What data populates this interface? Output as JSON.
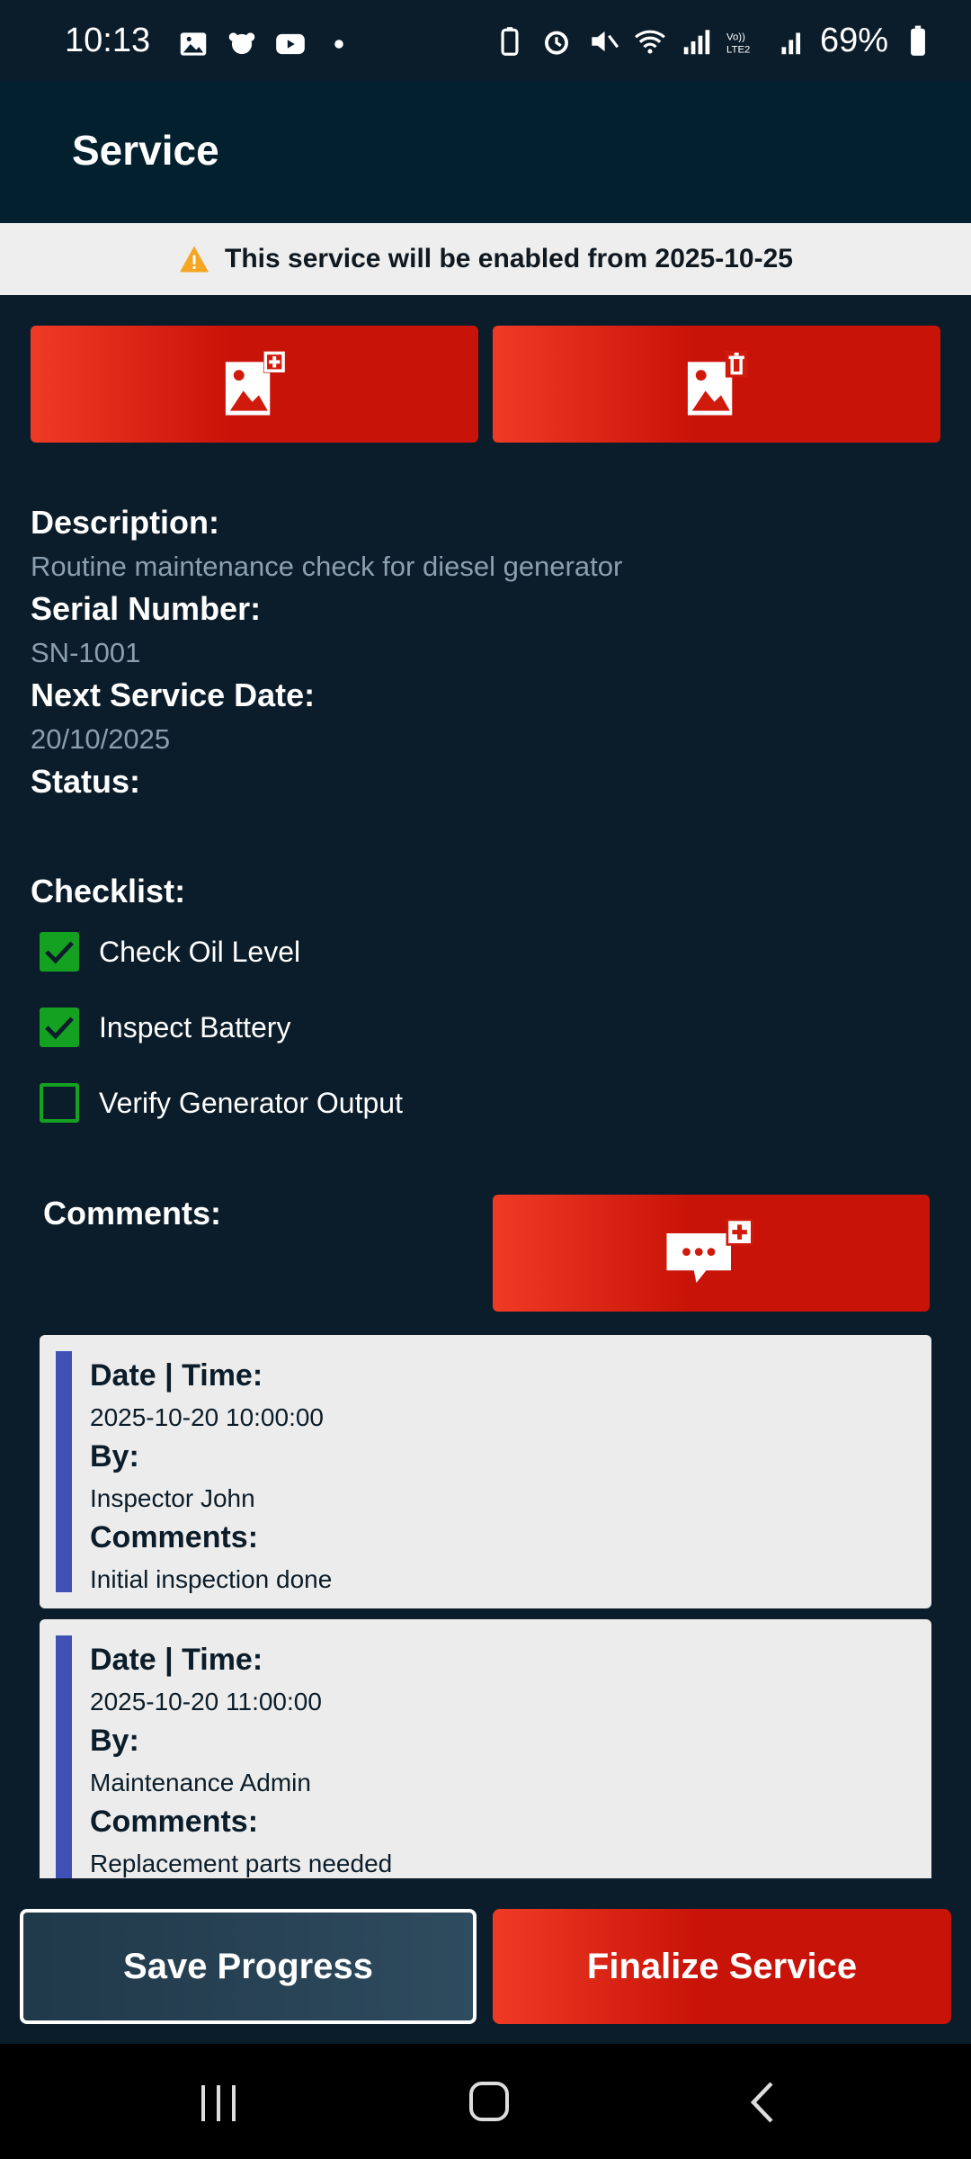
{
  "status_bar": {
    "time": "10:13",
    "battery": "69%"
  },
  "app_bar": {
    "title": "Service"
  },
  "banner": {
    "text": "This service will be enabled from 2025-10-25"
  },
  "details": {
    "description_label": "Description:",
    "description_value": "Routine maintenance check for diesel generator",
    "serial_label": "Serial Number:",
    "serial_value": "SN-1001",
    "next_date_label": "Next Service Date:",
    "next_date_value": "20/10/2025",
    "status_label": "Status:"
  },
  "checklist": {
    "label": "Checklist:",
    "items": [
      {
        "label": "Check Oil Level",
        "checked": true
      },
      {
        "label": "Inspect Battery",
        "checked": true
      },
      {
        "label": "Verify Generator Output",
        "checked": false
      }
    ]
  },
  "comments": {
    "label": "Comments:",
    "cards": [
      {
        "date_label": "Date | Time:",
        "date": "2025-10-20 10:00:00",
        "by_label": "By:",
        "by": "Inspector John",
        "comments_label": "Comments:",
        "comment": "Initial inspection done"
      },
      {
        "date_label": "Date | Time:",
        "date": "2025-10-20 11:00:00",
        "by_label": "By:",
        "by": "Maintenance Admin",
        "comments_label": "Comments:",
        "comment": "Replacement parts needed"
      }
    ]
  },
  "actions": {
    "save": "Save Progress",
    "finalize": "Finalize Service"
  },
  "colors": {
    "background": "#0b1d2a",
    "app_bar": "#03202f",
    "accent_red": "#c81308",
    "check_green": "#14a020",
    "card_bar": "#3f51b5"
  }
}
